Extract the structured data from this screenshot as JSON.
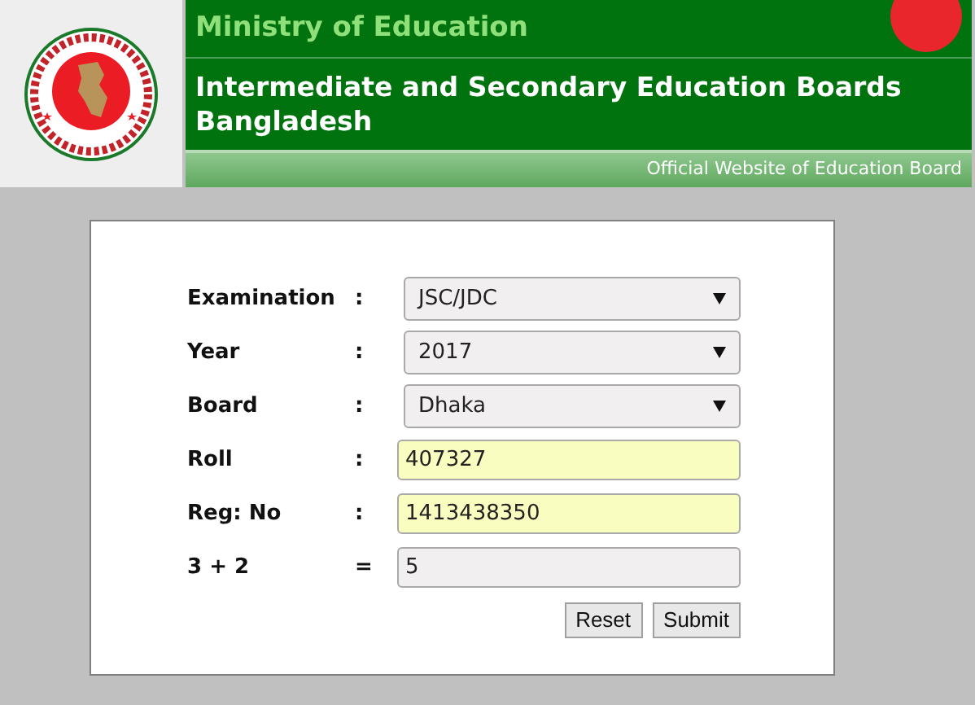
{
  "header": {
    "ministry": "Ministry of Education",
    "title": "Intermediate and Secondary Education Boards Bangladesh",
    "subtitle": "Official Website of Education Board"
  },
  "form": {
    "fields": [
      {
        "label": "Examination",
        "separator": ":",
        "kind": "select",
        "value": "JSC/JDC",
        "highlighted": false
      },
      {
        "label": "Year",
        "separator": ":",
        "kind": "select",
        "value": "2017",
        "highlighted": false
      },
      {
        "label": "Board",
        "separator": ":",
        "kind": "select",
        "value": "Dhaka",
        "highlighted": false
      },
      {
        "label": "Roll",
        "separator": ":",
        "kind": "input",
        "value": "407327",
        "highlighted": true
      },
      {
        "label": "Reg: No",
        "separator": ":",
        "kind": "input",
        "value": "1413438350",
        "highlighted": true
      },
      {
        "label": "3 + 2",
        "separator": "=",
        "kind": "input",
        "value": "5",
        "highlighted": false
      }
    ],
    "buttons": [
      "Reset",
      "Submit"
    ]
  }
}
